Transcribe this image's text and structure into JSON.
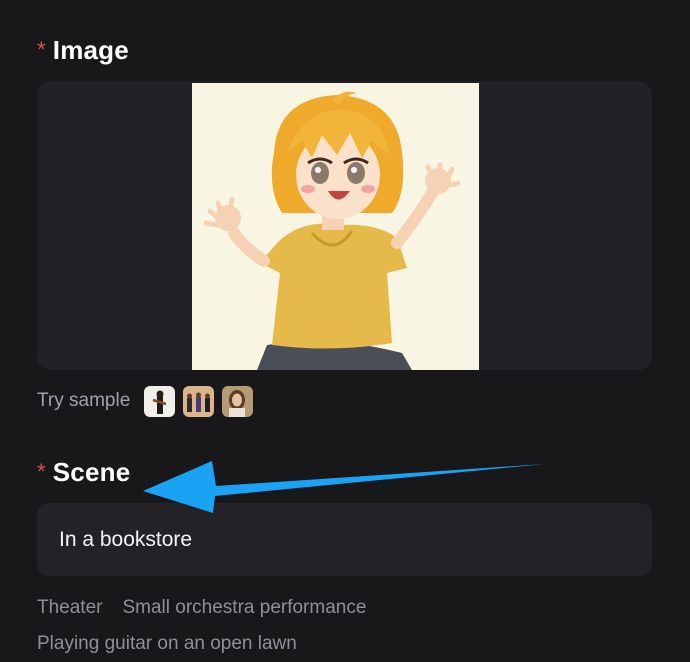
{
  "image_section": {
    "required_mark": "*",
    "title": "Image",
    "try_sample_label": "Try sample",
    "samples": [
      "violinist",
      "group-of-people",
      "woman-portrait"
    ]
  },
  "scene_section": {
    "required_mark": "*",
    "title": "Scene",
    "input_value": "In a bookstore",
    "suggestions": [
      "Theater",
      "Small orchestra performance",
      "Playing guitar on an open lawn"
    ]
  },
  "colors": {
    "background": "#18181b",
    "panel": "#232327",
    "required": "#e05252",
    "annotation_arrow": "#1aa3f5"
  }
}
